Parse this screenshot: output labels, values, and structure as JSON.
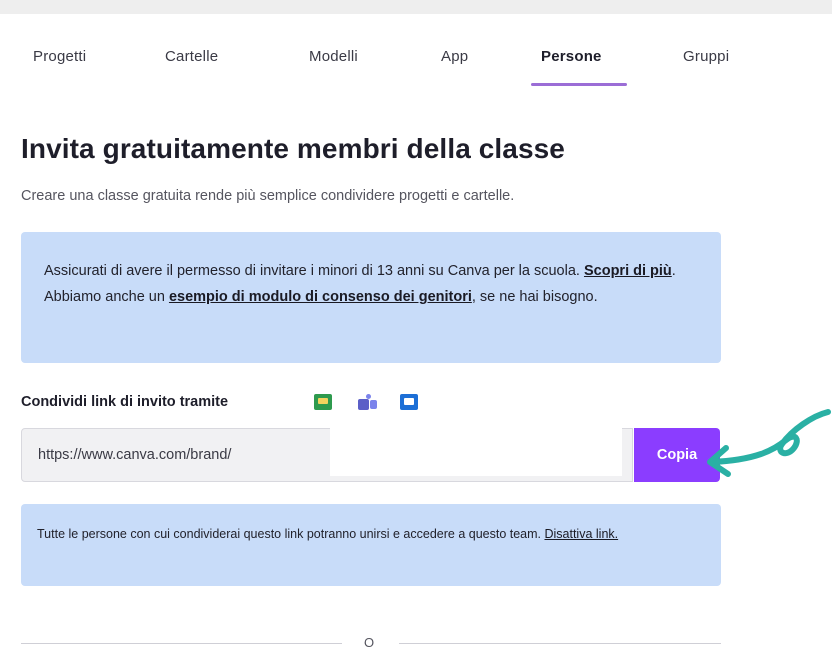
{
  "tabs": [
    {
      "label": "Progetti"
    },
    {
      "label": "Cartelle"
    },
    {
      "label": "Modelli"
    },
    {
      "label": "App"
    },
    {
      "label": "Persone"
    },
    {
      "label": "Gruppi"
    }
  ],
  "active_tab": "Persone",
  "heading": "Invita gratuitamente membri della classe",
  "subheading": "Creare una classe gratuita rende più semplice condividere progetti e cartelle.",
  "info": {
    "text_before_link": "Assicurati di avere il permesso di invitare i minori di 13 anni su Canva per la scuola. ",
    "learn_more_link": "Scopri di più",
    "text_middle": ". Abbiamo anche un ",
    "consent_link": "esempio di modulo di consenso dei genitori",
    "text_after": ", se ne hai bisogno."
  },
  "share": {
    "label": "Condividi link di invito tramite",
    "icons": [
      "google-classroom-icon",
      "microsoft-teams-icon",
      "message-icon"
    ],
    "link_value": "https://www.canva.com/brand/",
    "copy_label": "Copia"
  },
  "note": {
    "text": "Tutte le persone con cui condividerai questo link potranno unirsi e accedere a questo team. ",
    "disable_link": "Disattiva link."
  },
  "divider_text": "O",
  "colors": {
    "accent": "#8b3dff",
    "tab_underline": "#9b6dd6",
    "info_background": "#c8dcf9",
    "annotation_arrow": "#2ab0a4"
  }
}
